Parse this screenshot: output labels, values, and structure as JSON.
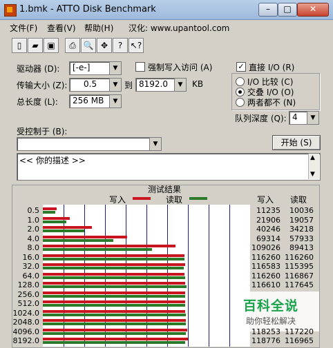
{
  "window": {
    "title": "1.bmk - ATTO Disk Benchmark",
    "min": "–",
    "max": "□",
    "close": "✕"
  },
  "menu": {
    "file": "文件(F)",
    "view": "查看(V)",
    "help": "帮助(H)",
    "site": "汉化: www.upantool.com"
  },
  "toolbar": {
    "icons": [
      "new-icon",
      "open-icon",
      "save-icon",
      "print-icon",
      "preview-icon",
      "move-icon",
      "help-icon",
      "context-help-icon"
    ],
    "glyphs": [
      "▯",
      "▰",
      "▣",
      "⎙",
      "🔍",
      "✥",
      "?",
      "↖?"
    ]
  },
  "form": {
    "drive_label": "驱动器 (D):",
    "drive_value": "[-e-]",
    "force_write_label": "强制写入访问 (A)",
    "force_write_checked": "",
    "transfer_label": "传输大小 (Z):",
    "transfer_from": "0.5",
    "to_label": "到",
    "transfer_to": "8192.0",
    "kb": "KB",
    "total_label": "总长度 (L):",
    "total_value": "256 MB",
    "direct_io_label": "直接 I/O (R)",
    "direct_io_checked": "✓",
    "io_compare_label": "I/O 比较 (C)",
    "overlapped_label": "交叠 I/O (O)",
    "neither_label": "两者都不 (N)",
    "queue_label": "队列深度 (Q):",
    "queue_value": "4",
    "controlled_label": "受控制于 (B):",
    "controlled_value": "",
    "start_button": "开始 (S)",
    "description": "<<   你的描述   >>"
  },
  "results": {
    "title": "测试结果",
    "write_legend": "写入",
    "read_legend": "读取",
    "write_col": "写入",
    "read_col": "读取"
  },
  "chart_data": {
    "type": "bar",
    "title": "测试结果",
    "categories": [
      "0.5",
      "1.0",
      "2.0",
      "4.0",
      "8.0",
      "16.0",
      "32.0",
      "64.0",
      "128.0",
      "256.0",
      "512.0",
      "1024.0",
      "2048.0",
      "4096.0",
      "8192.0"
    ],
    "series": [
      {
        "name": "写入",
        "color": "#c8141e",
        "values": [
          11235,
          21906,
          40246,
          69314,
          109026,
          116260,
          116583,
          116260,
          116610,
          116500,
          116600,
          116700,
          117200,
          118253,
          118776
        ]
      },
      {
        "name": "读取",
        "color": "#2a7a2a",
        "values": [
          10036,
          19057,
          34218,
          57933,
          89413,
          116260,
          115395,
          116867,
          117645,
          116900,
          117000,
          117100,
          117300,
          117220,
          116965
        ]
      }
    ],
    "table": [
      [
        "11235",
        "10036"
      ],
      [
        "21906",
        "19057"
      ],
      [
        "40246",
        "34218"
      ],
      [
        "69314",
        "57933"
      ],
      [
        "109026",
        "89413"
      ],
      [
        "116260",
        "116260"
      ],
      [
        "116583",
        "115395"
      ],
      [
        "116260",
        "116867"
      ],
      [
        "116610",
        "117645"
      ],
      [
        "",
        "",
        "hidden"
      ],
      [
        "",
        "",
        "hidden"
      ],
      [
        "",
        "",
        "hidden"
      ],
      [
        "",
        "",
        "hidden"
      ],
      [
        "118253",
        "117220"
      ],
      [
        "118776",
        "116965"
      ]
    ]
  },
  "watermark": {
    "title": "百科全说",
    "subtitle": "助你轻松解决"
  }
}
